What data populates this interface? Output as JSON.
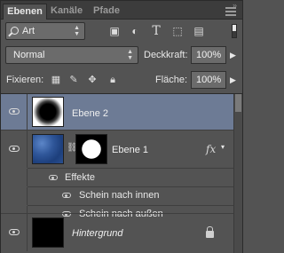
{
  "tabs": [
    {
      "label": "Ebenen",
      "active": true
    },
    {
      "label": "Kanäle",
      "active": false
    },
    {
      "label": "Pfade",
      "active": false
    }
  ],
  "filter": {
    "kind_label": "Art",
    "icons": [
      "image-filter-icon",
      "adjustment-filter-icon",
      "type-filter-icon",
      "shape-filter-icon",
      "smart-object-filter-icon"
    ]
  },
  "blend": {
    "mode": "Normal",
    "opacity_label": "Deckkraft:",
    "opacity_value": "100%"
  },
  "lock": {
    "label": "Fixieren:",
    "fill_label": "Fläche:",
    "fill_value": "100%"
  },
  "layers": [
    {
      "name": "Ebene 2",
      "selected": true,
      "visible": true
    },
    {
      "name": "Ebene 1",
      "selected": false,
      "visible": true,
      "has_mask": true,
      "has_fx": true,
      "effects_label": "Effekte",
      "effects": [
        "Schein nach innen",
        "Schein nach außen"
      ]
    },
    {
      "name": "Hintergrund",
      "selected": false,
      "visible": true,
      "locked": true
    }
  ],
  "colors": {
    "panel_bg": "#535353",
    "selected_row": "#6d7b95",
    "tab_bar": "#3c3c3c"
  }
}
